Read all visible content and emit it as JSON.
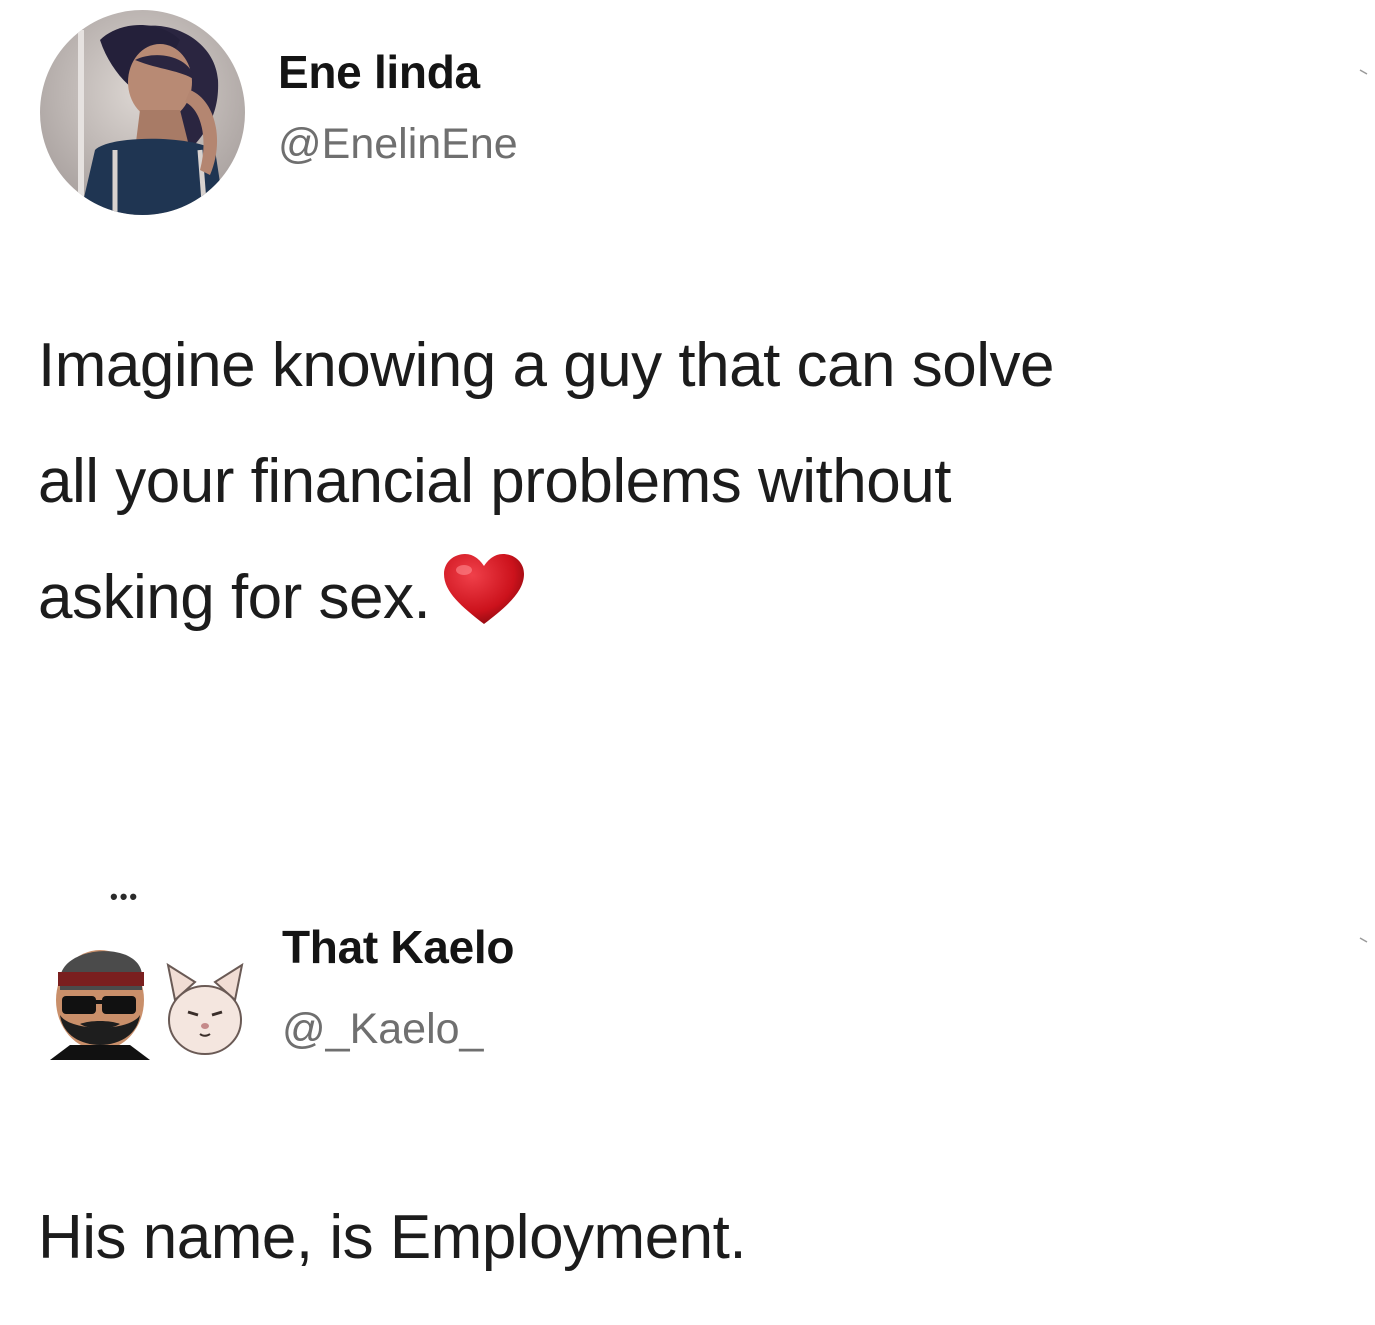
{
  "tweets": [
    {
      "display_name": "Ene linda",
      "handle": "@EnelinEne",
      "text_lines": [
        "Imagine knowing a guy that can solve",
        "all your financial problems without",
        "asking for sex."
      ],
      "emoji": "heart-icon",
      "avatar": "profile-photo-avatar"
    },
    {
      "display_name": "That Kaelo",
      "handle": "@_Kaelo_",
      "text_lines": [
        "His name, is Employment."
      ],
      "avatar": "bearded-man-cartoon-avatar",
      "avatar_extra": "cat-face-emoji-icon",
      "more_icon": "more-dots-icon"
    }
  ],
  "colors": {
    "heart": "#d0161f",
    "handle": "#6f6f6f",
    "text": "#1c1c1c"
  }
}
